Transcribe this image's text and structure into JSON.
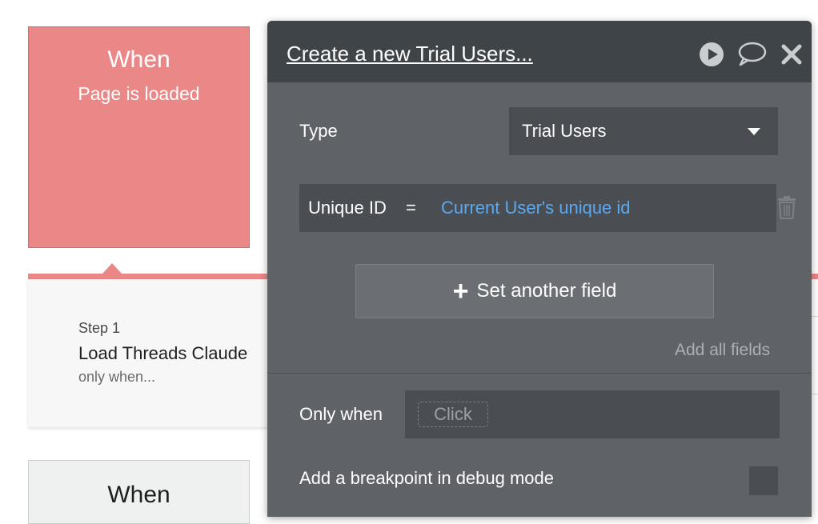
{
  "canvas": {
    "event_top": {
      "when": "When",
      "sub": "Page is loaded"
    },
    "step": {
      "number": "Step 1",
      "title": "Load Threads Claude",
      "condition": "only when..."
    },
    "event_bottom": {
      "when": "When"
    }
  },
  "panel": {
    "title": "Create a new Trial Users...",
    "icons": {
      "run": "play-icon",
      "comment": "comment-icon",
      "close": "close-icon"
    },
    "type_label": "Type",
    "type_value": "Trial Users",
    "field": {
      "name": "Unique ID",
      "operator": "=",
      "value": "Current User's unique id"
    },
    "set_field_label": "Set another field",
    "add_all_label": "Add all fields",
    "only_when_label": "Only when",
    "click_placeholder": "Click",
    "breakpoint_label": "Add a breakpoint in debug mode"
  },
  "colors": {
    "event_red": "#e98886",
    "panel_bg": "#5f6367",
    "panel_header": "#3f4448",
    "dynamic_value_blue": "#5aa9f0"
  }
}
